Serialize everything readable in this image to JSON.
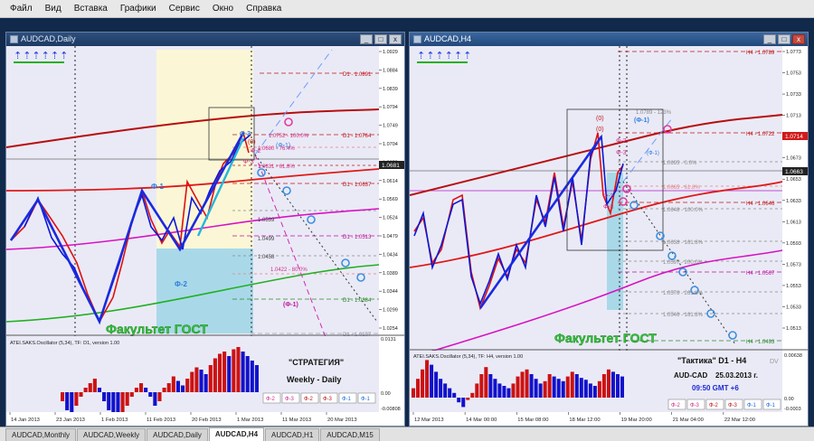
{
  "menu": [
    "Файл",
    "Вид",
    "Вставка",
    "Графики",
    "Сервис",
    "Окно",
    "Справка"
  ],
  "colors": {
    "up_bar": "#cc1111",
    "down_bar": "#1111cc",
    "zigzag_up": "#0b18d6",
    "zigzag_down": "#e01010",
    "chart_bg": "#eaeaf6",
    "axis_bg": "#ffffff"
  },
  "left": {
    "title": "AUDCAD,Daily",
    "arrows": "⇡⇡⇡⇡⇡⇡",
    "prices": [
      "1.0929",
      "1.0884",
      "1.0839",
      "1.0794",
      "1.0749",
      "1.0704",
      "1.0659",
      "1.0614",
      "1.0569",
      "1.0524",
      "1.0479",
      "1.0434",
      "1.0389",
      "1.0344",
      "1.0299",
      "1.0254"
    ],
    "current_price": "1.0681",
    "dates": [
      "14 Jan 2013",
      "23 Jan 2013",
      "1 Feb 2013",
      "11 Feb 2013",
      "20 Feb 2013",
      "1 Mar 2013",
      "11 Mar 2013",
      "20 Mar 2013"
    ],
    "levels": [
      {
        "text": "D1 - 1.0891",
        "color": "#c01818"
      },
      {
        "text": "D1 - 1.0764",
        "color": "#c01818"
      },
      {
        "text": "D1 - 1.0637",
        "color": "#c01818"
      },
      {
        "text": "D1 - 1.0513",
        "color": "#c0139a"
      },
      {
        "text": "D1 - 1.0384",
        "color": "#2a8a2a"
      },
      {
        "text": "D1 - 1.0257",
        "color": "#9aa0b0"
      }
    ],
    "fibo": [
      "1.0752 - 100.0%",
      "1.0680 - 76.4%",
      "1.0631 - 61.8%",
      "1.0539",
      "1.0499",
      "1.0458",
      "1.0422 - 80.0%"
    ],
    "labels": {
      "phi1": "Ф-1",
      "phi2": "Ф-2",
      "phi3": "Ф-3",
      "m2": "Ф-2",
      "m3": "Ф-3",
      "zero": "(0)",
      "phi1b": "(Ф-1)",
      "phim1": "(Ф-1)"
    },
    "watermark": "Факультет ГОСТ",
    "osc_title": "ATEI.SAKS.Oscillator (5,34), TF: D1, version 1.00",
    "osc_scale": [
      "0.0131",
      "0.00",
      "-0.00808"
    ],
    "strategy_title": "\"СТРАТЕГИЯ\"",
    "strategy_sub": "Weekly - Daily",
    "buttons": [
      "Ф-2",
      "Ф-3",
      "Ф-2",
      "Ф-3",
      "Ф-1",
      "Ф-1"
    ],
    "osc_values": [
      -0.2,
      -0.4,
      -0.5,
      -0.3,
      -0.1,
      0.1,
      0.2,
      0.3,
      0.1,
      -0.2,
      -0.4,
      -0.5,
      -0.6,
      -0.5,
      -0.3,
      -0.1,
      0.1,
      0.2,
      0.1,
      -0.1,
      -0.3,
      -0.2,
      0.1,
      0.2,
      0.35,
      0.25,
      0.15,
      0.3,
      0.45,
      0.55,
      0.5,
      0.4,
      0.6,
      0.75,
      0.85,
      0.9,
      0.8,
      0.95,
      1.0,
      0.9,
      0.8,
      0.7,
      0.6
    ]
  },
  "right": {
    "title": "AUDCAD,H4",
    "arrows": "⇡⇡⇡⇡⇡⇡",
    "prices": [
      "1.0773",
      "1.0753",
      "1.0733",
      "1.0713",
      "1.0693",
      "1.0673",
      "1.0653",
      "1.0633",
      "1.0613",
      "1.0593",
      "1.0573",
      "1.0553",
      "1.0533",
      "1.0513"
    ],
    "current_price": "1.0663",
    "marker_price": "1.0714",
    "dates": [
      "12 Mar 2013",
      "14 Mar 00:00",
      "15 Mar 08:00",
      "18 Mar 12:00",
      "19 Mar 20:00",
      "21 Mar 04:00",
      "22 Mar 12:00"
    ],
    "levels": [
      {
        "text": "H4 - 1.0789",
        "color": "#c01818"
      },
      {
        "text": "H4 - 1.0722",
        "color": "#c01818"
      },
      {
        "text": "H4 - 1.0646",
        "color": "#c01818"
      },
      {
        "text": "H4 - 1.0567",
        "color": "#c0139a"
      },
      {
        "text": "H4 - 1.0493",
        "color": "#2a8a2a"
      }
    ],
    "fibo": [
      "1.0789 - 123%",
      "1.0695 - 0.0%",
      "1.0665 - 61.8%",
      "1.0648 - 100.0%",
      "1.0638 - 161.8%",
      "1.0597 - 200.0%",
      "1.0576 - 261.8%",
      "1.0546 - 161.8%"
    ],
    "labels": {
      "zero": "(0)",
      "zero2": "(0)",
      "phi1": "(Ф-1)",
      "m2": "Ф-2",
      "m3": "Ф-3",
      "d2": "Ф-2",
      "d3": "Ф-3",
      "p1": "(Ф-1)"
    },
    "watermark": "Факультет ГОСТ",
    "osc_title": "ATEI.SAKS.Oscillator (5,34), TF: H4, version 1.00",
    "osc_scale": [
      "0.00638",
      "0.00",
      "-0.0003"
    ],
    "tactic_title": "\"Тактика\"  D1 - H4",
    "pair": "AUD-CAD",
    "date": "25.03.2013  г.",
    "time": "09:50  GMT +6",
    "dv": "DV",
    "buttons": [
      "Ф-2",
      "Ф-3",
      "Ф-2",
      "Ф-3",
      "Ф-1",
      "Ф-1"
    ],
    "osc_values": [
      0.2,
      0.4,
      0.6,
      0.8,
      0.7,
      0.55,
      0.4,
      0.3,
      0.2,
      0.1,
      -0.1,
      -0.2,
      -0.05,
      0.1,
      0.3,
      0.5,
      0.65,
      0.5,
      0.4,
      0.3,
      0.25,
      0.2,
      0.3,
      0.45,
      0.55,
      0.6,
      0.5,
      0.4,
      0.3,
      0.35,
      0.5,
      0.45,
      0.4,
      0.35,
      0.45,
      0.55,
      0.5,
      0.42,
      0.38,
      0.3,
      0.25,
      0.35,
      0.5,
      0.6,
      0.55,
      0.5,
      0.45
    ]
  },
  "tabs": [
    "AUDCAD,Monthly",
    "AUDCAD,Weekly",
    "AUDCAD,Daily",
    "AUDCAD,H4",
    "AUDCAD,H1",
    "AUDCAD,M15"
  ],
  "active_tab": 3
}
